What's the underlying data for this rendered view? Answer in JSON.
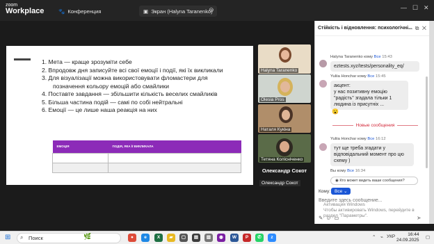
{
  "titlebar": {
    "logo_small": "zoom",
    "logo_big": "Workplace",
    "tabs": [
      {
        "label": "Конференция",
        "icon": "paw-icon"
      },
      {
        "label": "Экран (Halyna Taranenko)",
        "icon": "screen-icon"
      }
    ]
  },
  "slide": {
    "items": [
      "1.  Мета — краще зрозуміти себе",
      "2.  Впродовж дня записуйте всі свої емоції і події, які їх викликали",
      "3.  Для візуалізації можна використовувати фломастери для",
      "     позначення кольору емоцій або смайлики",
      "4.  Поставте завдання — збільшити кількість веселих смайликів",
      "5.  Більша частина подій — самі по собі нейтральні",
      "6.  Емоції — це лише наша реакція на них"
    ],
    "table_headers": [
      "ЕМОЦІЯ",
      "ПОДІЯ, ЯКА Її ВИКЛИКАЛА"
    ]
  },
  "participants": [
    {
      "name": "Halyna Taranenko"
    },
    {
      "name": "Olesia Pros"
    },
    {
      "name": "Наталя Кукіна"
    },
    {
      "name": "Тетяна Колісніченко"
    }
  ],
  "speaker": {
    "name": "Олександр Сокот",
    "tag": "Олександр Сокот"
  },
  "chat": {
    "title": "Стійкість і відновлення: психологічні...",
    "messages": [
      {
        "sender": "Halyna Taranenko",
        "to_label": "кому",
        "to": "Все",
        "time": "15:43",
        "text": "eztests.xyz/tests/personality_eq/"
      },
      {
        "sender": "Yuliia Honchar",
        "to_label": "кому",
        "to": "Все",
        "time": "15:45",
        "text": "акцент:\nу нас позитивну емоцію \"радість\" згадала тільки 1 людина із присутніх ..."
      },
      {
        "sender": "Yuliia Honchar",
        "to_label": "кому",
        "to": "Все",
        "time": "16:12",
        "text": "тут ще треба згадати у відповідальний момент про цю схему )"
      },
      {
        "sender": "Вы",
        "to_label": "кому",
        "to": "Все",
        "time": "16:34",
        "text": ""
      }
    ],
    "new_messages_label": "Новые сообщения",
    "reaction_emoji": "😮",
    "who_can_see": "Кто может видеть ваши сообщения?",
    "to_prefix": "Кому:",
    "to_value": "Все",
    "input_placeholder": "Введите здесь сообщение..."
  },
  "activation": {
    "line1": "Активация Windows",
    "line2": "Чтобы активировать Windows, перейдите в",
    "line3": "раздел \"Параметры\"."
  },
  "taskbar": {
    "search_placeholder": "Поиск",
    "lang": "УКР",
    "time": "16:44",
    "date": "24.09.2025"
  }
}
